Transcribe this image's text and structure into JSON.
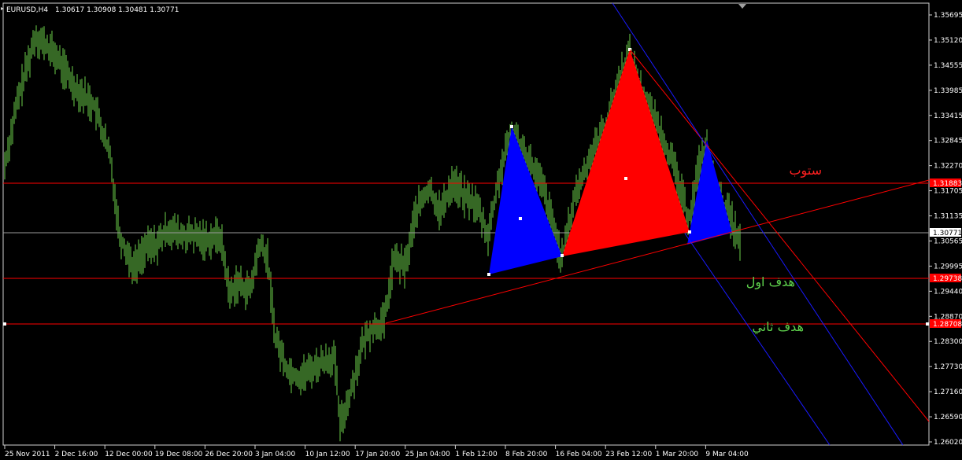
{
  "header": {
    "symbol_tf": "EURUSD,H4",
    "ohlc": "1.30617 1.30908 1.30481 1.30771"
  },
  "chart_data": {
    "type": "line",
    "title": "EURUSD,H4",
    "series": [],
    "ylim": [
      1.2602,
      1.3569
    ],
    "y_ticks": [
      "1.35695",
      "1.35120",
      "1.34555",
      "1.33985",
      "1.33415",
      "1.32845",
      "1.32270",
      "1.31705",
      "1.31135",
      "1.30565",
      "1.29995",
      "1.29440",
      "1.28870",
      "1.28300",
      "1.27730",
      "1.27160",
      "1.26590",
      "1.26020"
    ],
    "x_ticks": [
      "25 Nov 2011",
      "2 Dec 16:00",
      "12 Dec 00:00",
      "19 Dec 08:00",
      "26 Dec 20:00",
      "3 Jan 04:00",
      "10 Jan 12:00",
      "17 Jan 20:00",
      "25 Jan 04:00",
      "1 Feb 12:00",
      "8 Feb 20:00",
      "16 Feb 04:00",
      "23 Feb 12:00",
      "1 Mar 20:00",
      "9 Mar 04:00"
    ],
    "current_price": "1.30771",
    "price_labels": [
      {
        "value": 1.31883,
        "label": "1.31883",
        "color": "#ff0000"
      },
      {
        "value": 1.29738,
        "label": "1.29738",
        "color": "#ff0000"
      },
      {
        "value": 1.28708,
        "label": "1.28708",
        "color": "#ff0000"
      }
    ],
    "grid": false,
    "annotations": {
      "stop": "ستوب",
      "target1": "هدف اول",
      "target2": "هدف ثاني"
    },
    "colors": {
      "candle": "#6bd14a",
      "level": "#ff0000",
      "pattern_red": "#ff0000",
      "pattern_blue": "#0000ff",
      "channel_blue": "#1a1aff"
    }
  }
}
